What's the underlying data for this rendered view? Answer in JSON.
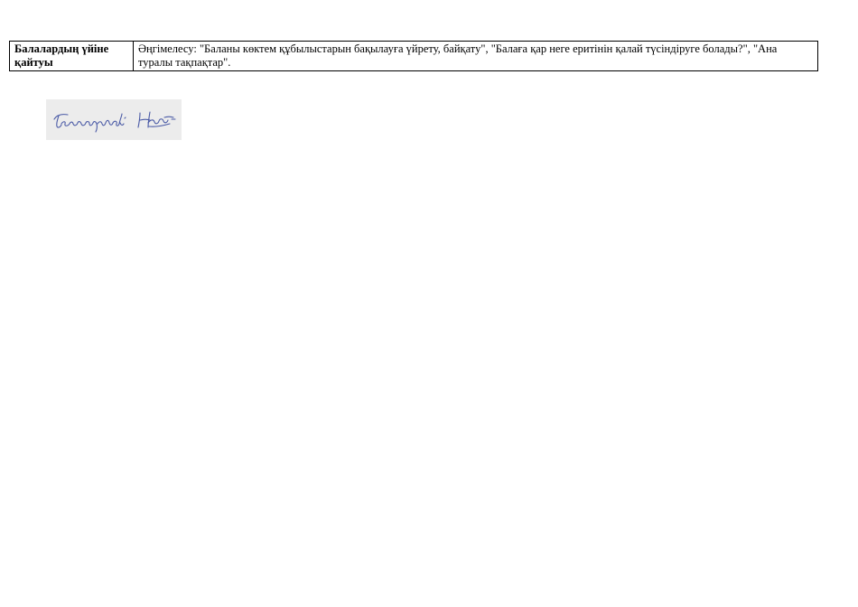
{
  "table": {
    "rows": [
      {
        "label": "Балалардың үйіне қайтуы",
        "content": "Әңгімелесу: \"Баланы көктем құбылыстарын бақылауға үйрету, байқату\", \"Балаға қар неге еритінін қалай түсіндіруге болады?\", \"Ана туралы тақпақтар\"."
      }
    ]
  },
  "signature": {
    "text": "Тексерілді",
    "ink_color": "#4a5aa6",
    "paper_color": "#ececec"
  }
}
